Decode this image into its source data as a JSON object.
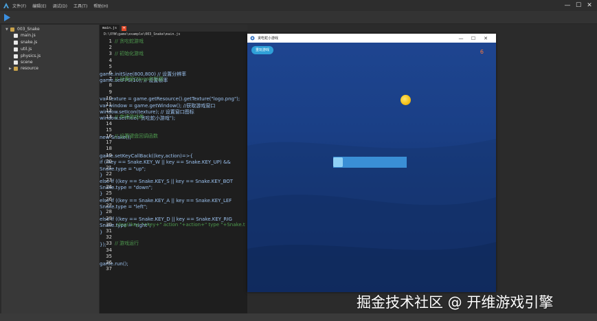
{
  "menu": [
    "文件(F)",
    "编辑(E)",
    "调试(D)",
    "工具(T)",
    "帮助(H)"
  ],
  "window_controls": {
    "minimize": "—",
    "maximize": "☐",
    "close": "✕"
  },
  "tree": {
    "root": "003_Snake",
    "files": [
      "main.js",
      "snake.js",
      "util.js",
      "physics.js",
      "scene",
      "resource"
    ]
  },
  "editor": {
    "tab_label": "main.js",
    "tab_close": "✕",
    "path": "D:\\XYW\\game\\example\\003_Snake\\main.js",
    "lines": [
      {
        "n": "1",
        "text": "// 贪吃蛇游戏",
        "kind": "comment"
      },
      {
        "n": "2",
        "text": "",
        "kind": "code"
      },
      {
        "n": "3",
        "text": "// 初始化游戏",
        "kind": "comment"
      },
      {
        "n": "4",
        "text": "game.initSize(800,800) // 设置分辨率",
        "kind": "code"
      },
      {
        "n": "5",
        "text": "game.setFPS(10); // 设置帧率",
        "kind": "code"
      },
      {
        "n": "6",
        "text": "",
        "kind": "code"
      },
      {
        "n": "7",
        "text": "// 设置窗口logo和标题",
        "kind": "comment"
      },
      {
        "n": "8",
        "text": "var texture = game.getResource().getTexture(\"logo.png\");",
        "kind": "code"
      },
      {
        "n": "9",
        "text": "var window = game.getWindow(); //获取游戏窗口",
        "kind": "code"
      },
      {
        "n": "10",
        "text": "window.setIcon(texture); // 设置窗口图标",
        "kind": "code"
      },
      {
        "n": "11",
        "text": "window.setTitle(\"贪吃蛇小游戏\");",
        "kind": "code"
      },
      {
        "n": "12",
        "text": "",
        "kind": "code"
      },
      {
        "n": "13",
        "text": "// 申请游戏类",
        "kind": "comment"
      },
      {
        "n": "14",
        "text": "new Snake();",
        "kind": "code"
      },
      {
        "n": "15",
        "text": "",
        "kind": "code"
      },
      {
        "n": "16",
        "text": "// 设置键盘回调函数",
        "kind": "comment"
      },
      {
        "n": "17",
        "text": "game.setKeyCallBack((key,action)=>{",
        "kind": "code"
      },
      {
        "n": "18",
        "text": "  if ((key == Snake.KEY_W || key == Snake.KEY_UP) &&",
        "kind": "code"
      },
      {
        "n": "19",
        "text": "      Snake.type = \"up\";",
        "kind": "code"
      },
      {
        "n": "20",
        "text": "  }",
        "kind": "code"
      },
      {
        "n": "21",
        "text": "  else if ((key == Snake.KEY_S || key == Snake.KEY_BOT",
        "kind": "code"
      },
      {
        "n": "22",
        "text": "      Snake.type = \"down\";",
        "kind": "code"
      },
      {
        "n": "23",
        "text": "  }",
        "kind": "code"
      },
      {
        "n": "24",
        "text": "  else if ((key == Snake.KEY_A || key == Snake.KEY_LEF",
        "kind": "code"
      },
      {
        "n": "25",
        "text": "      Snake.type = \"left\";",
        "kind": "code"
      },
      {
        "n": "26",
        "text": "  }",
        "kind": "code"
      },
      {
        "n": "27",
        "text": "  else if ((key == Snake.KEY_D || key == Snake.KEY_RIG",
        "kind": "code"
      },
      {
        "n": "28",
        "text": "      Snake.type = \"right\";",
        "kind": "code"
      },
      {
        "n": "29",
        "text": "  }",
        "kind": "code"
      },
      {
        "n": "30",
        "text": "  //log(\"key \"+key+\" action \"+action+\" type \"+Snake.t",
        "kind": "comment"
      },
      {
        "n": "31",
        "text": "});",
        "kind": "code"
      },
      {
        "n": "32",
        "text": "",
        "kind": "code"
      },
      {
        "n": "33",
        "text": "// 游戏运行",
        "kind": "comment"
      },
      {
        "n": "34",
        "text": "game.run();",
        "kind": "code"
      },
      {
        "n": "35",
        "text": "",
        "kind": "code"
      },
      {
        "n": "36",
        "text": "",
        "kind": "code"
      },
      {
        "n": "37",
        "text": "",
        "kind": "code"
      }
    ]
  },
  "game_window": {
    "title": "贪吃蛇小游戏",
    "controls": {
      "minimize": "—",
      "maximize": "☐",
      "close": "✕"
    },
    "restart_label": "重玩游戏",
    "score": "6"
  },
  "watermark": "掘金技术社区 @ 开维游戏引擎",
  "colors": {
    "accent": "#2fa0d8",
    "score": "#ff7a3c",
    "snake_body": "#3a8fd6",
    "snake_head": "#8fd0f5",
    "food": "#f5c21a"
  }
}
